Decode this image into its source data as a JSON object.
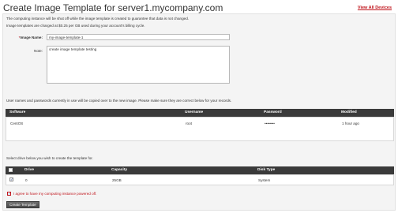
{
  "header": {
    "title": "Create Image Template for server1.mycompany.com",
    "view_all": "View All Devices"
  },
  "notices": {
    "line1": "The computing instance will be shut off while the image template is created to guarantee that data is not changed.",
    "line2": "Image templates are charged at $0.25 per GB used during your account's billing cycle."
  },
  "form": {
    "image_name_label": "Image Name:",
    "image_name_required_mark": "*",
    "image_name_value": "my-image-template-1",
    "note_label": "Note:",
    "note_value": "create image template testing"
  },
  "credentials_notice": "User names and passwords currently in use will be copied over to the new image. Please make sure they are correct below for your records.",
  "software_table": {
    "headers": [
      "Software",
      "Username",
      "Password",
      "Modified"
    ],
    "rows": [
      [
        "CentOS",
        "root",
        "••••••••",
        "1 hour ago"
      ]
    ]
  },
  "drive_notice": "Select drive below you wish to create the template for.",
  "drive_table": {
    "headers": [
      "",
      "Drive",
      "Capacity",
      "Disk Type"
    ],
    "rows": [
      {
        "checked": true,
        "drive": "0",
        "capacity": "25GB",
        "disk_type": "System"
      }
    ]
  },
  "agree": {
    "checked": true,
    "label": "I agree to have my computing instance powered off."
  },
  "submit_label": "Create Template",
  "colors": {
    "accent_red": "#c0141b",
    "table_header": "#3a3a3a",
    "panel_bg": "#f4f4f4"
  }
}
